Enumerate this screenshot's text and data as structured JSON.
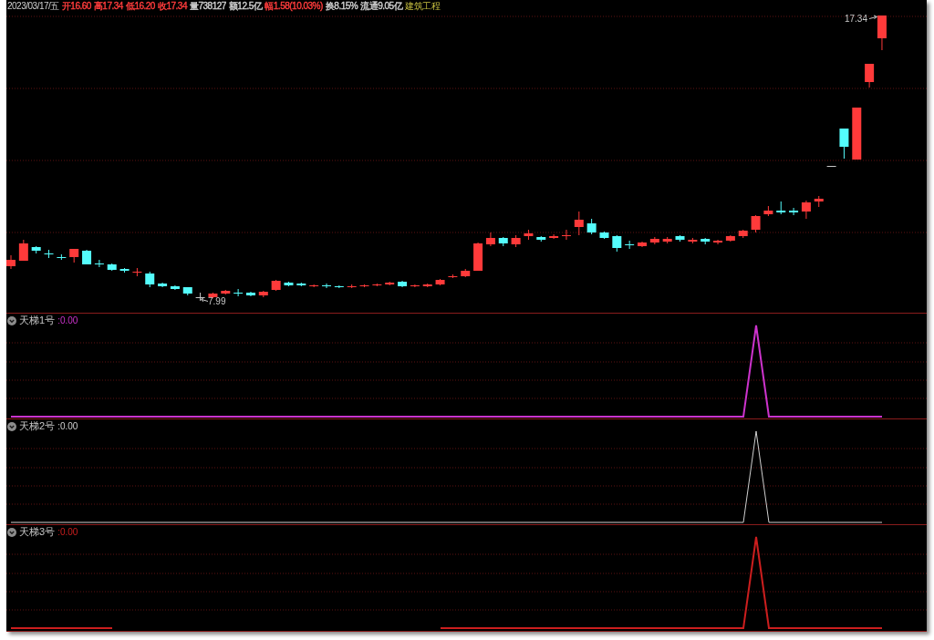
{
  "quote_bar": {
    "date": "2023/03/17/五",
    "fields": [
      {
        "label": "开",
        "value": "16.60",
        "color": "#ff3c3c"
      },
      {
        "label": "高",
        "value": "17.34",
        "color": "#ff3c3c"
      },
      {
        "label": "低",
        "value": "16.20",
        "color": "#ff3c3c"
      },
      {
        "label": "收",
        "value": "17.34",
        "color": "#ff3c3c"
      },
      {
        "label": "量",
        "value": "738127",
        "color": "#d0d0d0"
      },
      {
        "label": "额",
        "value": "12.5亿",
        "color": "#d0d0d0"
      },
      {
        "label": "幅",
        "value": "1.58(10.03%)",
        "color": "#ff3c3c"
      },
      {
        "label": "换",
        "value": "8.15%",
        "color": "#d0d0d0"
      },
      {
        "label": "流通",
        "value": "9.05亿",
        "color": "#d0d0d0"
      }
    ],
    "sector": "建筑工程"
  },
  "price_chart": {
    "high_label": "17.34",
    "low_label": "7.99"
  },
  "indicators": [
    {
      "name": "天梯1号",
      "value": ":0.00",
      "color": "#cc33cc"
    },
    {
      "name": "天梯2号",
      "value": ":0.00",
      "color": "#d0d0d0"
    },
    {
      "name": "天梯3号",
      "value": ":0.00",
      "color": "#cc1e1e"
    }
  ]
}
